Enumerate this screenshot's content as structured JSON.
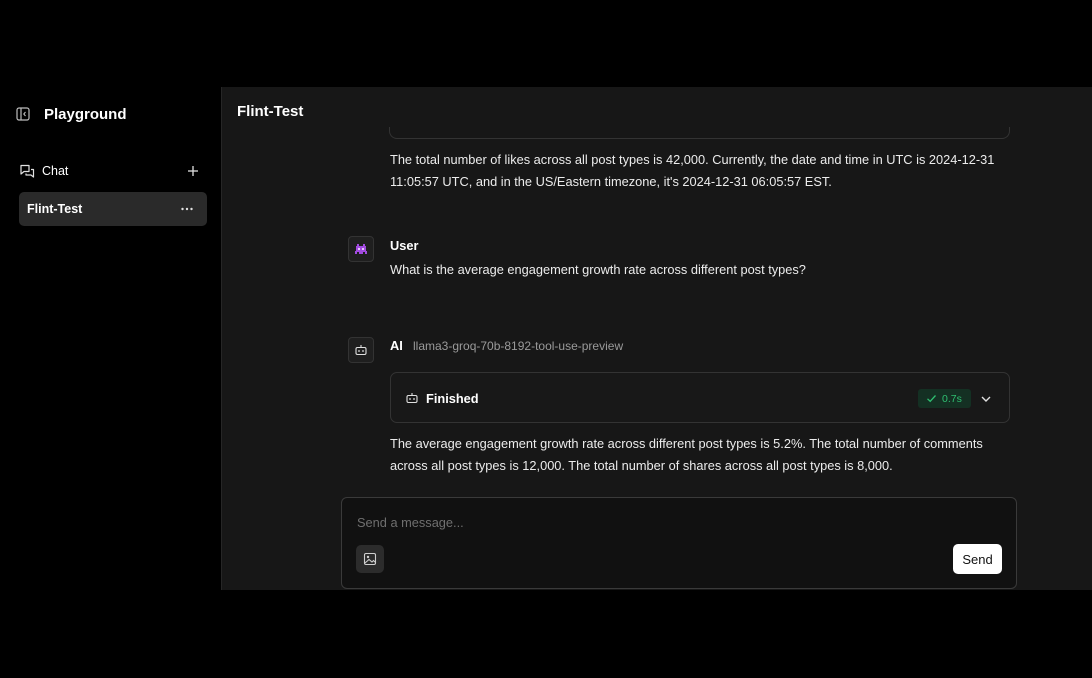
{
  "sidebar": {
    "brand": "Playground",
    "chat_label": "Chat",
    "conversations": [
      {
        "label": "Flint-Test"
      }
    ]
  },
  "main": {
    "title": "Flint-Test",
    "messages": [
      {
        "role": "ai",
        "text": "The total number of likes across all post types is 42,000. Currently, the date and time in UTC is 2024-12-31 11:05:57 UTC, and in the US/Eastern timezone, it's 2024-12-31 06:05:57 EST."
      },
      {
        "role": "user",
        "sender": "User",
        "text": "What is the average engagement growth rate across different post types?"
      },
      {
        "role": "ai",
        "sender": "AI",
        "model": "llama3-groq-70b-8192-tool-use-preview",
        "tool": {
          "status": "Finished",
          "duration": "0.7s"
        },
        "text": "The average engagement growth rate across different post types is 5.2%. The total number of comments across all post types is 12,000. The total number of shares across all post types is 8,000."
      }
    ]
  },
  "composer": {
    "placeholder": "Send a message...",
    "send_label": "Send"
  },
  "colors": {
    "accent_success": "#2fbf71",
    "avatar_purple": "#a24be0"
  }
}
